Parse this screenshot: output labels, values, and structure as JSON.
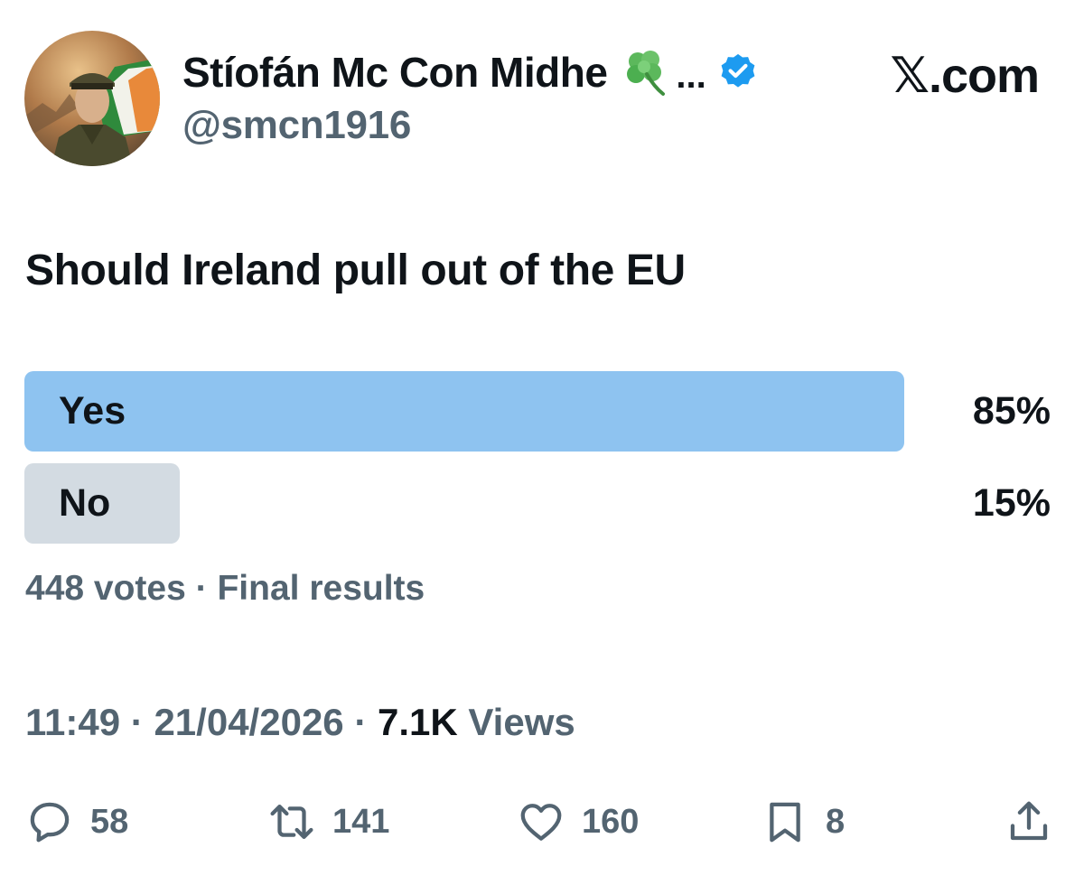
{
  "author": {
    "display_name": "Stíofán Mc Con Midhe",
    "ellipsis": "...",
    "handle": "@smcn1916",
    "emoji_icon": "shamrock-icon",
    "verified_icon": "verified-badge-icon",
    "avatar": "portrait-avatar"
  },
  "brand": "𝕏.com",
  "poll": {
    "question": "Should Ireland pull out of the EU",
    "options": [
      {
        "label": "Yes",
        "percent_text": "85%",
        "share": 0.85,
        "color": "#8ec3f0"
      },
      {
        "label": "No",
        "percent_text": "15%",
        "share": 0.15,
        "color": "#d3dbe2"
      }
    ],
    "votes": "448 votes",
    "separator": "·",
    "status": "Final results"
  },
  "meta": {
    "time": "11:49",
    "date": "21/04/2026",
    "views_count": "7.1K",
    "views_label": "Views"
  },
  "actions": {
    "reply": {
      "icon": "reply-icon",
      "count": "58"
    },
    "retweet": {
      "icon": "retweet-icon",
      "count": "141"
    },
    "like": {
      "icon": "heart-icon",
      "count": "160"
    },
    "bookmark": {
      "icon": "bookmark-icon",
      "count": "8"
    },
    "share": {
      "icon": "share-icon"
    }
  },
  "colors": {
    "text_primary": "#0f1419",
    "text_secondary": "#536471",
    "verified_blue": "#1d9bf0"
  }
}
